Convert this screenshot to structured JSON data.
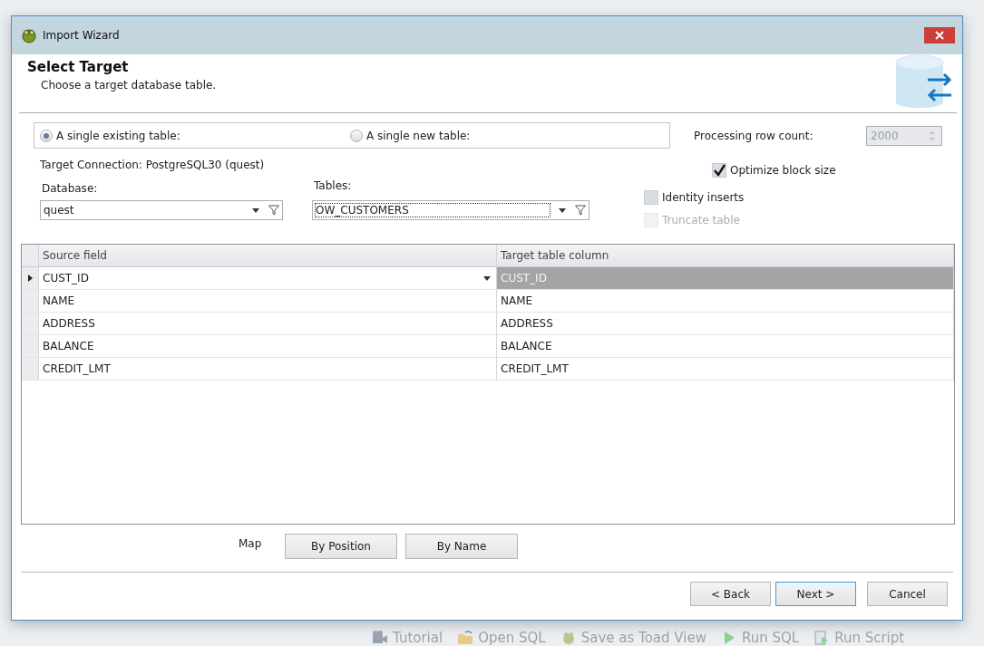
{
  "window": {
    "title": "Import Wizard"
  },
  "header": {
    "title": "Select Target",
    "subtitle": "Choose a target database table."
  },
  "target_options": [
    {
      "label": "A single existing table:",
      "selected": true
    },
    {
      "label": "A single new table:",
      "selected": false
    }
  ],
  "processing_row_count": {
    "label": "Processing row count:",
    "value": "2000",
    "disabled": true
  },
  "target_connection": "Target Connection: PostgreSQL30 (quest)",
  "database": {
    "label": "Database:",
    "value": "quest",
    "focused": false
  },
  "tables": {
    "label": "Tables:",
    "value": "OW_CUSTOMERS",
    "focused": true
  },
  "options": [
    {
      "label": "Optimize block size",
      "checked": true,
      "disabled": false
    },
    {
      "label": "Identity inserts",
      "checked": false,
      "disabled": false
    },
    {
      "label": "Truncate table",
      "checked": false,
      "disabled": true
    }
  ],
  "mapping_grid": {
    "columns": [
      "Source field",
      "Target table column"
    ],
    "rows": [
      {
        "source": "CUST_ID",
        "target": "CUST_ID",
        "selected": true
      },
      {
        "source": "NAME",
        "target": "NAME",
        "selected": false
      },
      {
        "source": "ADDRESS",
        "target": "ADDRESS",
        "selected": false
      },
      {
        "source": "BALANCE",
        "target": "BALANCE",
        "selected": false
      },
      {
        "source": "CREDIT_LMT",
        "target": "CREDIT_LMT",
        "selected": false
      }
    ]
  },
  "map": {
    "label": "Map",
    "buttons": [
      "By Position",
      "By Name"
    ]
  },
  "nav_buttons": [
    {
      "label": "< Back",
      "default": false
    },
    {
      "label": "Next >",
      "default": true
    },
    {
      "label": "Cancel",
      "default": false
    }
  ],
  "background_toolbar": [
    {
      "label": "Tutorial",
      "kind": "camera"
    },
    {
      "label": "Open SQL",
      "kind": "folder"
    },
    {
      "label": "Save as Toad View",
      "kind": "toad"
    },
    {
      "label": "Run SQL",
      "kind": "play"
    },
    {
      "label": "Run Script",
      "kind": "script"
    }
  ]
}
